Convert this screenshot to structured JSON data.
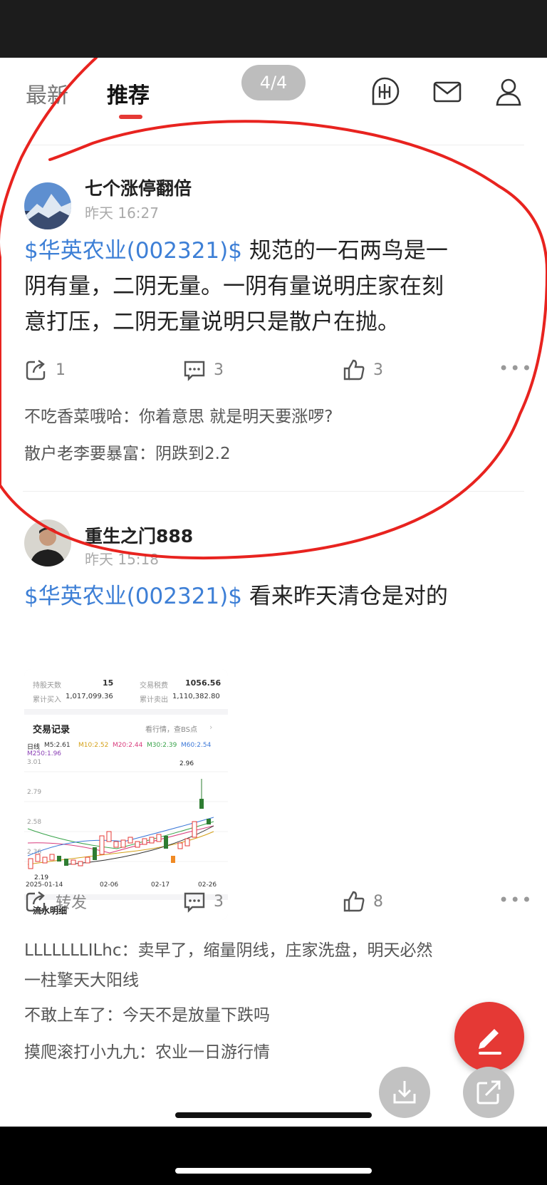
{
  "header": {
    "tabs": [
      {
        "label": "最新",
        "active": false
      },
      {
        "label": "推荐",
        "active": true
      }
    ],
    "page_indicator": "4/4",
    "icons": [
      "funds-icon",
      "mail-icon",
      "profile-icon"
    ]
  },
  "posts": [
    {
      "username": "七个涨停翻倍",
      "time": "昨天 16:27",
      "stock": "$华英农业(002321)$",
      "text_lines": [
        "规范的一石两鸟是一",
        "阴有量，二阴无量。一阴有量说明庄家在刻",
        "意打压，二阴无量说明只是散户在抛。"
      ],
      "share_count": "1",
      "comment_count": "3",
      "like_count": "3",
      "comments": [
        {
          "author": "不吃香菜哦哈",
          "text": "你着意思 就是明天要涨啰?"
        },
        {
          "author": "散户老李要暴富",
          "text": "阴跌到2.2"
        }
      ]
    },
    {
      "username": "重生之门888",
      "time": "昨天 15:18",
      "stock": "$华英农业(002321)$",
      "text": "看来昨天清仓是对的",
      "share_label": "转发",
      "comment_count": "3",
      "like_count": "8",
      "image": {
        "hold_days_label": "持股天数",
        "hold_days": "15",
        "fee_label": "交易税费",
        "fee": "1056.56",
        "buy_label": "累计买入",
        "buy": "1,017,099.36",
        "sell_label": "累计卖出",
        "sell": "1,110,382.80",
        "records_title": "交易记录",
        "records_link": "看行情，查BS点",
        "ma_line": "日线",
        "ma5": "M5:2.61",
        "ma10": "M10:2.52",
        "ma20": "M20:2.44",
        "ma30": "M30:2.39",
        "ma60": "M60:2.54",
        "ma250": "M250:1.96",
        "price_labels": [
          "3.01",
          "2.79",
          "2.58",
          "2.36"
        ],
        "high_label": "2.96",
        "low_label": "2.19",
        "dates": [
          "2025-01-14",
          "02-06",
          "02-17",
          "02-26"
        ],
        "footer_title": "流水明细"
      },
      "comments": [
        {
          "author": "LLLLLLLILhc",
          "text": "卖早了，缩量阴线，庄家洗盘，明天必然",
          "text2": "一柱擎天大阳线"
        },
        {
          "author": "不敢上车了",
          "text": "今天不是放量下跌吗"
        },
        {
          "author": "摸爬滚打小九九",
          "text": "农业一日游行情"
        }
      ]
    }
  ],
  "colors": {
    "accent": "#e53935",
    "link": "#3d7fd6",
    "annotation": "#e8231f"
  }
}
